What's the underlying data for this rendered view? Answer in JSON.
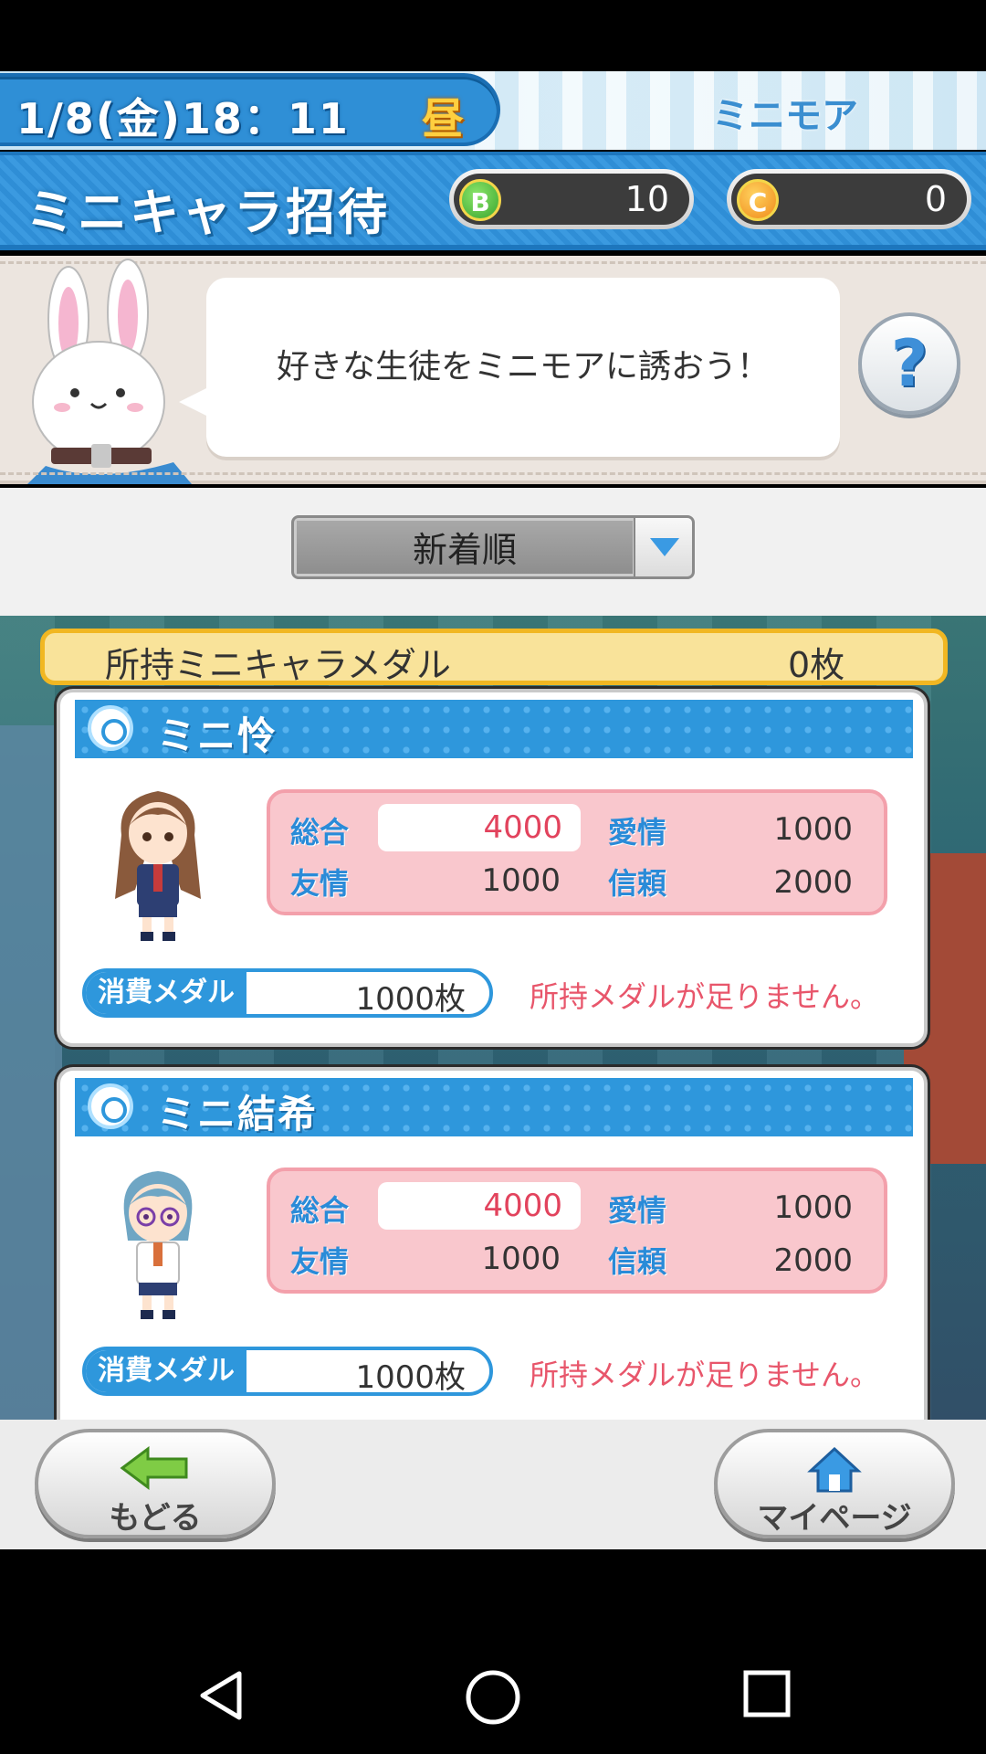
{
  "datebar": {
    "datetime": "1/8(金)18：11",
    "daytime": "昼",
    "location": "ミニモア"
  },
  "header": {
    "title": "ミニキャラ招待",
    "currency_b": {
      "icon": "B",
      "value": "10"
    },
    "currency_c": {
      "icon": "C",
      "value": "0"
    }
  },
  "speech": {
    "message": "好きな生徒をミニモアに誘おう！",
    "help": "?"
  },
  "sort": {
    "selected": "新着順"
  },
  "medals": {
    "label": "所持ミニキャラメダル",
    "value": "0枚"
  },
  "cards": [
    {
      "name": "ミニ怜",
      "stats": {
        "total_label": "総合",
        "total": "4000",
        "love_label": "愛情",
        "love": "1000",
        "friend_label": "友情",
        "friend": "1000",
        "trust_label": "信頼",
        "trust": "2000"
      },
      "cost_label": "消費メダル",
      "cost": "1000枚",
      "warning": "所持メダルが足りません。"
    },
    {
      "name": "ミニ結希",
      "stats": {
        "total_label": "総合",
        "total": "4000",
        "love_label": "愛情",
        "love": "1000",
        "friend_label": "友情",
        "friend": "1000",
        "trust_label": "信頼",
        "trust": "2000"
      },
      "cost_label": "消費メダル",
      "cost": "1000枚",
      "warning": "所持メダルが足りません。"
    }
  ],
  "nav": {
    "back": "もどる",
    "mypage": "マイページ"
  },
  "colors": {
    "accent_blue": "#2e97dc",
    "warning_red": "#e8566b",
    "total_red": "#e2435d",
    "medal_gold": "#f1b722"
  }
}
